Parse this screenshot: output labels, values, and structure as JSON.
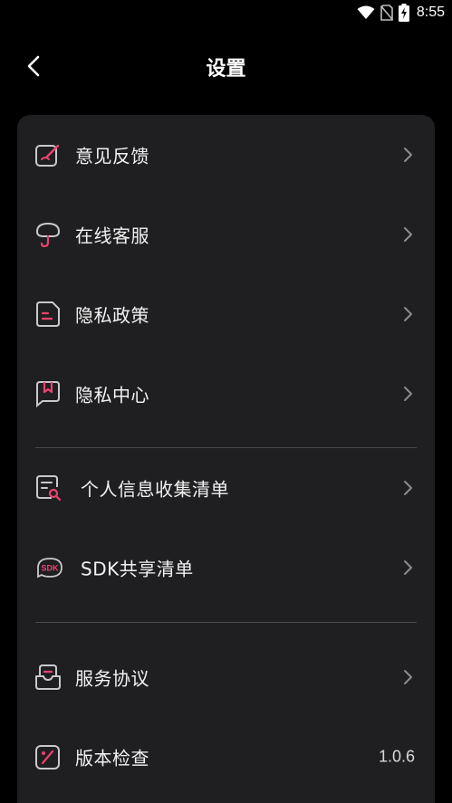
{
  "status_bar": {
    "time": "8:55",
    "icons": [
      "wifi-icon",
      "no-sim-icon",
      "battery-charging-icon"
    ]
  },
  "header": {
    "title": "设置",
    "back_icon": "chevron-left-icon"
  },
  "settings": {
    "group1": [
      {
        "label": "意见反馈",
        "icon": "feedback-edit-icon"
      },
      {
        "label": "在线客服",
        "icon": "customer-service-icon"
      },
      {
        "label": "隐私政策",
        "icon": "privacy-policy-doc-icon"
      },
      {
        "label": "隐私中心",
        "icon": "privacy-center-bookmark-icon"
      }
    ],
    "group2": [
      {
        "label": "个人信息收集清单",
        "icon": "info-list-search-icon"
      },
      {
        "label": "SDK共享清单",
        "icon": "sdk-badge-icon"
      }
    ],
    "group3": [
      {
        "label": "服务协议",
        "icon": "service-agreement-icon"
      },
      {
        "label": "版本检查",
        "icon": "version-check-icon",
        "value": "1.0.6"
      }
    ]
  },
  "colors": {
    "background": "#000000",
    "card": "#1f1f21",
    "accent_pink": "#e8436e",
    "icon_gray": "#c9c9cc",
    "divider": "#4a4a4c"
  }
}
